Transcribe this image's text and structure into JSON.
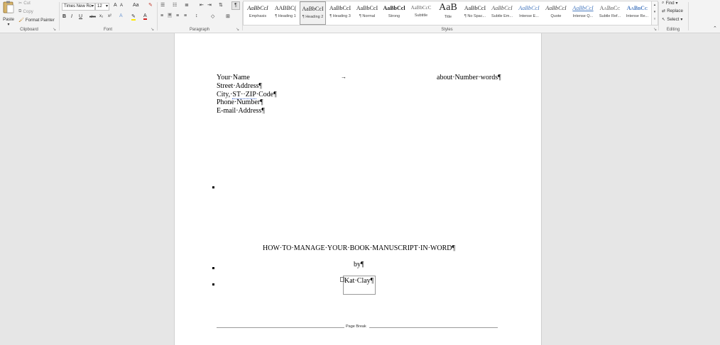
{
  "clipboard": {
    "paste": "Paste",
    "cut": "Cut",
    "copy": "Copy",
    "format_painter": "Format Painter",
    "label": "Clipboard"
  },
  "font": {
    "name": "Times New Ro",
    "size": "12",
    "label": "Font",
    "buttons": [
      "A",
      "A",
      "Aa",
      "B",
      "I",
      "U",
      "abc",
      "x₂",
      "x²"
    ]
  },
  "paragraph": {
    "label": "Paragraph"
  },
  "styles": {
    "label": "Styles",
    "items": [
      {
        "sample": "AaBbCcI",
        "name": "Emphasis"
      },
      {
        "sample": "AABBC(",
        "name": "¶ Heading 1"
      },
      {
        "sample": "AaBbCcI",
        "name": "¶ Heading 2"
      },
      {
        "sample": "AaBbCcI",
        "name": "¶ Heading 3"
      },
      {
        "sample": "AaBbCcI",
        "name": "¶ Normal"
      },
      {
        "sample": "AaBbCcl",
        "name": "Strong"
      },
      {
        "sample": "AaBbCcC",
        "name": "Subtitle"
      },
      {
        "sample": "AaB",
        "name": "Title"
      },
      {
        "sample": "AaBbCcI",
        "name": "¶ No Spac..."
      },
      {
        "sample": "AaBbCcI",
        "name": "Subtle Em..."
      },
      {
        "sample": "AaBbCcI",
        "name": "Intense E..."
      },
      {
        "sample": "AaBbCcI",
        "name": "Quote"
      },
      {
        "sample": "AaBbCcI",
        "name": "Intense Q..."
      },
      {
        "sample": "AaBbCc",
        "name": "Subtle Ref..."
      },
      {
        "sample": "AaBbCc",
        "name": "Intense Re..."
      }
    ]
  },
  "editing": {
    "find": "Find",
    "replace": "Replace",
    "select": "Select",
    "label": "Editing"
  },
  "document": {
    "your_name": "Your·Name",
    "word_count": "about·Number·words¶",
    "street": "Street·Address¶",
    "city_prefix": "City,·",
    "city_st_zip": "ST··ZIP",
    "city_suffix": "·Code¶",
    "phone": "Phone·Number¶",
    "email": "E-mail·Address¶",
    "title": "HOW·TO·MANAGE·YOUR·BOOK·MANUSCRIPT·IN·WORD¶",
    "by": "by¶",
    "author": "Kat·Clay¶",
    "page_break": "Page Break"
  }
}
